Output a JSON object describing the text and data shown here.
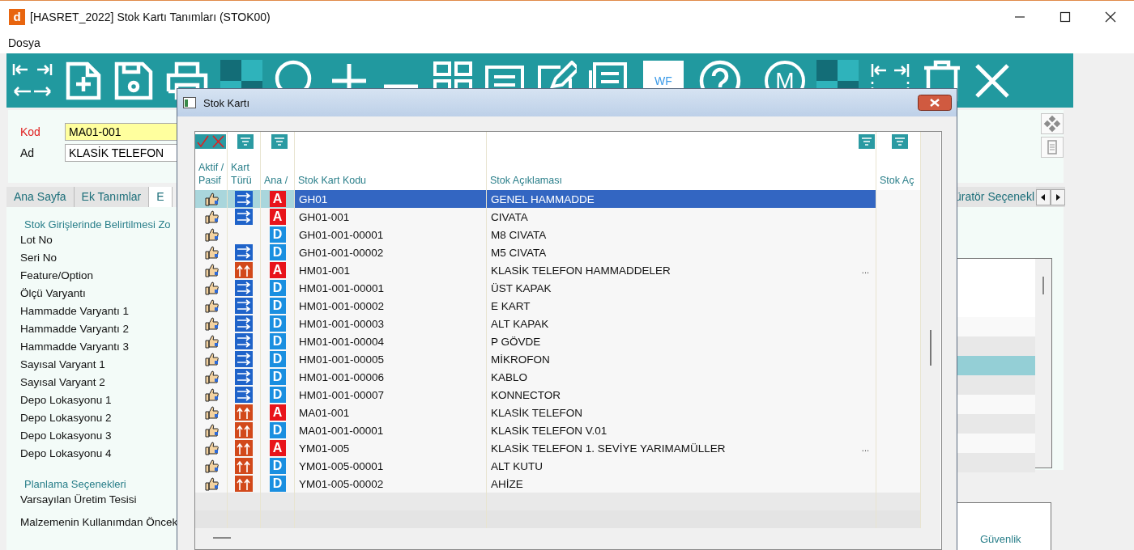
{
  "window": {
    "logo": "d",
    "title": "[HASRET_2022] Stok Kartı Tanımları (STOK00)"
  },
  "menu": [
    "Dosya"
  ],
  "toolbar": {
    "wf_label": "WF",
    "m_label": "M"
  },
  "form": {
    "fields": [
      {
        "label": "Kod",
        "value": "MA01-001",
        "required": true
      },
      {
        "label": "Ad",
        "value": "KLASİK TELEFON",
        "required": false
      }
    ]
  },
  "tabs": [
    {
      "label": "Ana Sayfa",
      "selected": false
    },
    {
      "label": "Ek Tanımlar",
      "selected": false
    },
    {
      "label": "E",
      "selected": true
    }
  ],
  "tabs_right": {
    "label": "üratör Seçenekl",
    "selected": false
  },
  "left_panel": {
    "sections": [
      {
        "title": "Stok Girişlerinde Belirtilmesi Zo",
        "items": [
          "Lot No",
          "Seri No",
          "Feature/Option",
          "Ölçü Varyantı",
          "Hammadde Varyantı 1",
          "Hammadde Varyantı 2",
          "Hammadde Varyantı 3",
          "Sayısal Varyant 1",
          "Sayısal Varyant 2",
          "Depo Lokasyonu 1",
          "Depo Lokasyonu 2",
          "Depo Lokasyonu 3",
          "Depo Lokasyonu 4"
        ]
      },
      {
        "title": "Planlama Seçenekleri",
        "items": [
          "Varsayılan Üretim Tesisi",
          "Malzemenin Kullanımdan Öncek"
        ]
      }
    ]
  },
  "right_panel": {
    "rows": [
      {
        "selected": false
      },
      {
        "selected": false
      },
      {
        "selected": true
      },
      {
        "selected": false
      },
      {
        "selected": false
      },
      {
        "selected": false
      },
      {
        "selected": false
      },
      {
        "selected": false
      }
    ],
    "footer_label": "Güvenlik"
  },
  "dialog": {
    "title": "Stok Kartı",
    "columns": [
      {
        "label": "Aktif / Pasif",
        "kind": "check-cross"
      },
      {
        "label": "Kart Türü",
        "kind": "filter"
      },
      {
        "label": "Ana /",
        "kind": "filter"
      },
      {
        "label": "Stok Kart Kodu",
        "kind": "plain"
      },
      {
        "label": "Stok Açıklaması",
        "kind": "filter"
      },
      {
        "label": "Stok Aç",
        "kind": "filter"
      }
    ],
    "rows": [
      {
        "active": true,
        "card_type": {
          "kind": "right"
        },
        "badge": {
          "text": "A",
          "color": "#e8141b"
        },
        "code": "GH01",
        "description": "GENEL HAMMADDE",
        "selected": true
      },
      {
        "active": true,
        "card_type": {
          "kind": "right"
        },
        "badge": {
          "text": "A",
          "color": "#e8141b"
        },
        "code": "GH01-001",
        "description": "CIVATA",
        "selected": false
      },
      {
        "active": true,
        "badge": {
          "text": "D",
          "color": "#1a8fe0"
        },
        "code": "GH01-001-00001",
        "description": "M8 CIVATA",
        "selected": false
      },
      {
        "active": true,
        "card_type": {
          "kind": "right"
        },
        "badge": {
          "text": "D",
          "color": "#1a8fe0"
        },
        "code": "GH01-001-00002",
        "description": "M5 CIVATA",
        "selected": false
      },
      {
        "active": true,
        "card_type": {
          "kind": "up"
        },
        "badge": {
          "text": "A",
          "color": "#e8141b"
        },
        "code": "HM01-001",
        "description": "KLASİK TELEFON HAMMADDELER",
        "more": "...",
        "selected": false
      },
      {
        "active": true,
        "card_type": {
          "kind": "right"
        },
        "badge": {
          "text": "D",
          "color": "#1a8fe0"
        },
        "code": "HM01-001-00001",
        "description": "ÜST KAPAK",
        "selected": false
      },
      {
        "active": true,
        "card_type": {
          "kind": "right"
        },
        "badge": {
          "text": "D",
          "color": "#1a8fe0"
        },
        "code": "HM01-001-00002",
        "description": "E KART",
        "selected": false
      },
      {
        "active": true,
        "card_type": {
          "kind": "right"
        },
        "badge": {
          "text": "D",
          "color": "#1a8fe0"
        },
        "code": "HM01-001-00003",
        "description": "ALT KAPAK",
        "selected": false
      },
      {
        "active": true,
        "card_type": {
          "kind": "right"
        },
        "badge": {
          "text": "D",
          "color": "#1a8fe0"
        },
        "code": "HM01-001-00004",
        "description": "P GÖVDE",
        "selected": false
      },
      {
        "active": true,
        "card_type": {
          "kind": "right"
        },
        "badge": {
          "text": "D",
          "color": "#1a8fe0"
        },
        "code": "HM01-001-00005",
        "description": "MİKROFON",
        "selected": false
      },
      {
        "active": true,
        "card_type": {
          "kind": "right"
        },
        "badge": {
          "text": "D",
          "color": "#1a8fe0"
        },
        "code": "HM01-001-00006",
        "description": "KABLO",
        "selected": false
      },
      {
        "active": true,
        "card_type": {
          "kind": "right"
        },
        "badge": {
          "text": "D",
          "color": "#1a8fe0"
        },
        "code": "HM01-001-00007",
        "description": "KONNECTOR",
        "selected": false
      },
      {
        "active": true,
        "card_type": {
          "kind": "up"
        },
        "badge": {
          "text": "A",
          "color": "#e8141b"
        },
        "code": "MA01-001",
        "description": "KLASİK TELEFON",
        "selected": false
      },
      {
        "active": true,
        "card_type": {
          "kind": "up"
        },
        "badge": {
          "text": "D",
          "color": "#1a8fe0"
        },
        "code": "MA01-001-00001",
        "description": "KLASİK TELEFON V.01",
        "selected": false
      },
      {
        "active": true,
        "card_type": {
          "kind": "up"
        },
        "badge": {
          "text": "A",
          "color": "#e8141b"
        },
        "code": "YM01-005",
        "description": "KLASİK TELEFON 1. SEVİYE YARIMAMÜLLER",
        "more": "...",
        "selected": false
      },
      {
        "active": true,
        "card_type": {
          "kind": "up"
        },
        "badge": {
          "text": "D",
          "color": "#1a8fe0"
        },
        "code": "YM01-005-00001",
        "description": "ALT KUTU",
        "selected": false
      },
      {
        "active": true,
        "card_type": {
          "kind": "up"
        },
        "badge": {
          "text": "D",
          "color": "#1a8fe0"
        },
        "code": "YM01-005-00002",
        "description": "AHİZE",
        "selected": false
      }
    ]
  }
}
